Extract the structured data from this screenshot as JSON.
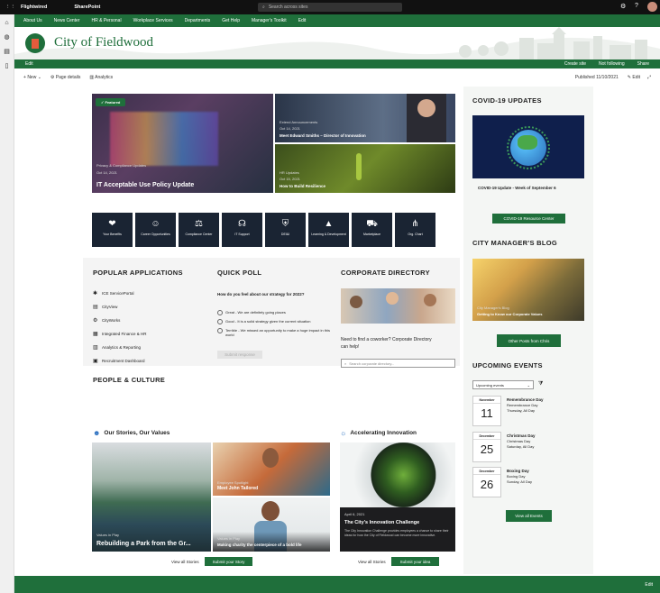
{
  "topbar": {
    "app": "Flightwired",
    "site": "SharePoint",
    "search_placeholder": "Search across sites"
  },
  "nav": {
    "items": [
      "About Us",
      "News Center",
      "HR & Personal",
      "Workplace Services",
      "Departments",
      "Get Help",
      "Manager's Toolkit",
      "Edit"
    ]
  },
  "site": {
    "title": "City of Fieldwood"
  },
  "greenbar": {
    "left": "Edit",
    "right": [
      "Create site",
      "Not following",
      "Share"
    ]
  },
  "cmdbar": {
    "new": "New",
    "page_details": "Page details",
    "analytics": "Analytics",
    "published": "Published 11/10/2021",
    "edit": "Edit"
  },
  "hero": {
    "main": {
      "badge": "Featured",
      "meta": "Privacy & Compliance Updates",
      "date": "Oct 14, 2021",
      "title": "IT Acceptable Use Policy Update"
    },
    "top_right": {
      "meta": "Extend Announcements",
      "date": "Oct 14, 2021",
      "title": "Meet Edward Smiths – Director of Innovation"
    },
    "bottom_right": {
      "meta": "HR Updates",
      "date": "Oct 15, 2021",
      "title": "How to Build Resilience"
    }
  },
  "quicklinks": [
    "Your Benefits",
    "Career Opportunities",
    "Compliance Center",
    "IT Support",
    "DEI&I",
    "Learning & Development",
    "Marketplace",
    "Org. Chart"
  ],
  "popular": {
    "title": "POPULAR APPLICATIONS",
    "apps": [
      "ICE ServicePortal",
      "CityView",
      "CityWorks",
      "Integrated Finance & HR",
      "Analytics & Reporting",
      "Recruitment Dashboard"
    ]
  },
  "poll": {
    "title": "QUICK POLL",
    "question": "How do you feel about our strategy for 2022?",
    "options": [
      "Great - We are definitely going places",
      "Good - It is a solid strategy given the current situation",
      "Terrible - We missed an opportunity to make a huge impact in this world"
    ],
    "submit": "Submit response"
  },
  "directory": {
    "title": "CORPORATE DIRECTORY",
    "text": "Need to find a coworker? Corporate Directory can help!",
    "placeholder": "Search corporate directory..."
  },
  "people": {
    "title": "PEOPLE & CULTURE",
    "stories": {
      "title": "Our Stories, Our Values",
      "main_meta": "Values in Play",
      "main_title": "Rebuilding a Park from the Gr...",
      "tr_meta": "Employee Spotlight",
      "tr_title": "Meet John Tailored",
      "br_meta": "Values in Play",
      "br_title": "Making charity the centerpiece of a bold life",
      "view_all": "View all Stories",
      "submit": "Submit your Story"
    },
    "innovation": {
      "title": "Accelerating Innovation",
      "meta": "April 6, 2021",
      "card_title": "The City's Innovation Challenge",
      "desc": "The City Innovation Challenge provides employees a chance to share their ideas for how the City of Fieldwood can become more innovative.",
      "view_all": "View all Stories",
      "submit": "Submit your idea"
    }
  },
  "side": {
    "covid_title": "COVID-19 UPDATES",
    "covid_caption": "COVID-19 Update - Week of September 6",
    "covid_button": "COVID-19 Resource Center",
    "blog_title": "CITY MANAGER'S BLOG",
    "blog_meta": "City Manager's Blog",
    "blog_caption": "Getting to Know our Corporate Values",
    "blog_button": "Other Posts from Chris",
    "events_title": "UPCOMING EVENTS",
    "events_filter": "Upcoming events",
    "events": [
      {
        "month": "November",
        "day": "11",
        "title": "Remembrance Day",
        "sub": "Remembrance Day",
        "when": "Thursday, All Day"
      },
      {
        "month": "December",
        "day": "25",
        "title": "Christmas Day",
        "sub": "Christmas Day",
        "when": "Saturday, All Day"
      },
      {
        "month": "December",
        "day": "26",
        "title": "Boxing Day",
        "sub": "Boxing Day",
        "when": "Sunday, All Day"
      }
    ],
    "events_button": "View all Events"
  },
  "footer": {
    "label": "Edit"
  },
  "colors": {
    "brand": "#1f6f3b",
    "dark": "#1a2433"
  }
}
